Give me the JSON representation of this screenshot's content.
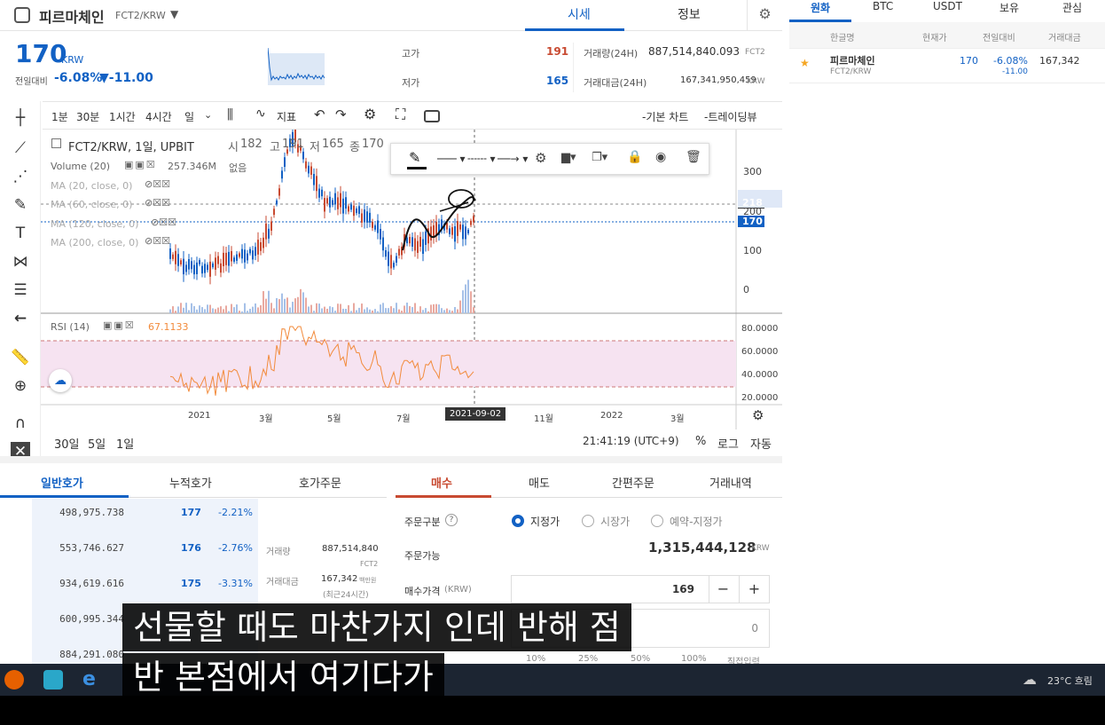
{
  "header": {
    "coin_name": "피르마체인",
    "coin_pair": "FCT2/KRW",
    "tab_price": "시세",
    "tab_info": "정보"
  },
  "price": {
    "current": "170",
    "unit": "KRW",
    "change_label": "전일대비",
    "change_pct": "-6.08%",
    "change_abs": "▼-11.00",
    "high_label": "고가",
    "high": "191",
    "low_label": "저가",
    "low": "165",
    "volume_label": "거래량(24H)",
    "volume": "887,514,840.093",
    "volume_unit": "FCT2",
    "amount_label": "거래대금(24H)",
    "amount": "167,341,950,459",
    "amount_unit": "KRW"
  },
  "toolbar": {
    "t1m": "1분",
    "t30m": "30분",
    "t1h": "1시간",
    "t4h": "4시간",
    "tday": "일",
    "indicator": "지표",
    "basic_chart": "-기본 차트",
    "tradingview": "-트레이딩뷰"
  },
  "chart": {
    "symbol_line": "FCT2/KRW, 1일, UPBIT",
    "ohlc_open_label": "시",
    "ohlc_open": "182",
    "ohlc_high_label": "고",
    "ohlc_high": "191",
    "ohlc_low_label": "저",
    "ohlc_low": "165",
    "ohlc_close_label": "종",
    "ohlc_close": "170",
    "volume_legend": "Volume (20)",
    "volume_value": "257.346M",
    "volume_none": "없음",
    "ma1": "MA (20, close, 0)",
    "ma2": "MA (60, close, 0)",
    "ma3": "MA (120, close, 0)",
    "ma4": "MA (200, close, 0)",
    "rsi_legend": "RSI (14)",
    "rsi_value": "67.1133",
    "price_ticks": [
      "300",
      "200",
      "100",
      "0"
    ],
    "price_tag_1": "218",
    "price_tag_2": "170",
    "rsi_ticks": [
      "80.0000",
      "60.0000",
      "40.0000",
      "20.0000"
    ],
    "x_ticks": [
      "2021",
      "3월",
      "5월",
      "7월",
      "11월",
      "2022",
      "3월"
    ],
    "x_cursor": "2021-09-02",
    "range_30d": "30일",
    "range_5d": "5일",
    "range_1d": "1일",
    "clock": "21:41:19 (UTC+9)",
    "pct": "%",
    "log": "로그",
    "auto": "자동"
  },
  "orderbook": {
    "tab_general": "일반호가",
    "tab_cumulative": "누적호가",
    "tab_order": "호가주문",
    "rows": [
      {
        "qty": "498,975.738",
        "price": "177",
        "pct": "-2.21%"
      },
      {
        "qty": "553,746.627",
        "price": "176",
        "pct": "-2.76%"
      },
      {
        "qty": "934,619.616",
        "price": "175",
        "pct": "-3.31%"
      },
      {
        "qty": "600,995.344",
        "price": "",
        "pct": ""
      },
      {
        "qty": "884,291.080",
        "price": "",
        "pct": ""
      }
    ],
    "side_volume_label": "거래량",
    "side_volume": "887,514,840",
    "side_volume_unit": "FCT2",
    "side_amount_label": "거래대금",
    "side_amount": "167,342",
    "side_amount_unit": "백만원",
    "side_amount_note": "(최근24시간)"
  },
  "order": {
    "tab_buy": "매수",
    "tab_sell": "매도",
    "tab_simple": "간편주문",
    "tab_history": "거래내역",
    "type_label": "주문구분",
    "type_limit": "지정가",
    "type_market": "시장가",
    "type_reserve": "예약-지정가",
    "available_label": "주문가능",
    "available": "1,315,444,128",
    "available_unit": "KRW",
    "price_label": "매수가격",
    "price_unit": "(KRW)",
    "price_value": "169",
    "qty_value": "0",
    "pct_options": [
      "10%",
      "25%",
      "50%",
      "100%"
    ],
    "direct_input": "직접입력"
  },
  "right_panel": {
    "tabs": [
      "원화",
      "BTC",
      "USDT",
      "보유",
      "관심"
    ],
    "headers": [
      "한글명",
      "현재가",
      "전일대비",
      "거래대금"
    ],
    "row_name": "피르마체인",
    "row_pair": "FCT2/KRW",
    "row_price": "170",
    "row_pct": "-6.08%",
    "row_abs": "-11.00",
    "row_amount": "167,342"
  },
  "taskbar": {
    "weather": "23°C 흐림"
  },
  "subtitle": {
    "line1": "선물할 때도 마찬가지 인데 반해 점",
    "line2": "반 본점에서 여기다가"
  },
  "colors": {
    "accent": "#1261c4",
    "up": "#c84a31",
    "rsi": "#f28b3c"
  }
}
